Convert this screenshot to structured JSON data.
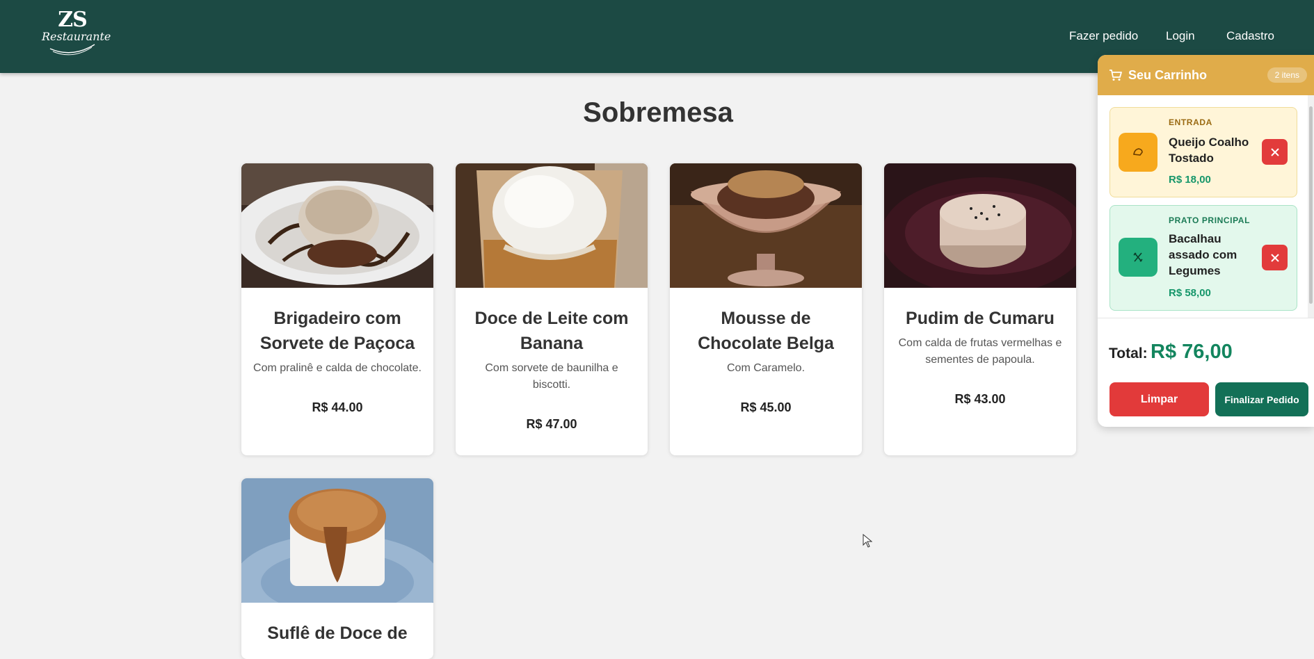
{
  "header": {
    "logo_line1": "ZS",
    "logo_line2": "Restaurante",
    "nav": [
      {
        "label": "Fazer pedido"
      },
      {
        "label": "Login"
      },
      {
        "label": "Cadastro"
      }
    ]
  },
  "section": {
    "title": "Sobremesa"
  },
  "products": [
    {
      "name": "Brigadeiro com Sorvete de Paçoca",
      "description": "Com pralinê e calda de chocolate.",
      "price": "R$ 44.00"
    },
    {
      "name": "Doce de Leite com Banana",
      "description": "Com sorvete de baunilha e biscotti.",
      "price": "R$ 47.00"
    },
    {
      "name": "Mousse de Chocolate Belga",
      "description": "Com Caramelo.",
      "price": "R$ 45.00"
    },
    {
      "name": "Pudim de Cumaru",
      "description": "Com calda de frutas vermelhas e sementes de papoula.",
      "price": "R$ 43.00"
    },
    {
      "name": "Suflê de Doce de",
      "description": "",
      "price": ""
    }
  ],
  "cart": {
    "title": "Seu Carrinho",
    "count_badge": "2 itens",
    "items": [
      {
        "category": "ENTRADA",
        "name": "Queijo Coalho Tostado",
        "price": "R$ 18,00",
        "icon": "bread-icon",
        "accent": "#f5a623",
        "bg": "#fff6d9"
      },
      {
        "category": "PRATO PRINCIPAL",
        "name": "Bacalhau assado com Legumes",
        "price": "R$ 58,00",
        "icon": "utensils-icon",
        "accent": "#1aa777",
        "bg": "#e4f9ee"
      }
    ],
    "total_label": "Total:",
    "total_value": "R$ 76,00",
    "clear_label": "Limpar",
    "finish_label": "Finalizar Pedido"
  },
  "colors": {
    "header_bg": "#1c4a44",
    "cart_header": "#e0ac4a",
    "total_green": "#13855e",
    "clear_red": "#e23a3a",
    "finish_green": "#137057"
  }
}
